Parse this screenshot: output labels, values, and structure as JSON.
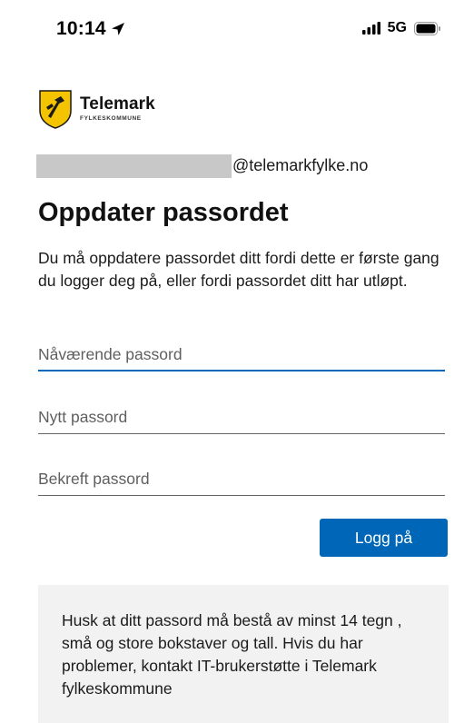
{
  "status_bar": {
    "time": "10:14",
    "network": "5G",
    "icons": [
      "location-arrow-icon",
      "signal-bars-icon",
      "battery-icon"
    ]
  },
  "brand": {
    "name": "Telemark",
    "subtitle": "FYLKESKOMMUNE",
    "logo_colors": {
      "shield": "#f5c400",
      "emblem": "#1a1a1a"
    }
  },
  "account": {
    "domain": "@telemarkfylke.no"
  },
  "page": {
    "title": "Oppdater passordet",
    "description": "Du må oppdatere passordet ditt fordi dette er første gang du logger deg på, eller fordi passordet ditt har utløpt."
  },
  "form": {
    "current_password_placeholder": "Nåværende passord",
    "new_password_placeholder": "Nytt passord",
    "confirm_password_placeholder": "Bekreft passord",
    "submit_label": "Logg på"
  },
  "notice": {
    "text": "Husk at ditt passord må bestå av minst 14 tegn , små og store bokstaver og tall. Hvis du har problemer, kontakt IT-brukerstøtte i Telemark fylkeskommune"
  },
  "colors": {
    "accent": "#0067b8",
    "notice_bg": "#f2f2f2",
    "masked_field": "#c8c8c8"
  }
}
